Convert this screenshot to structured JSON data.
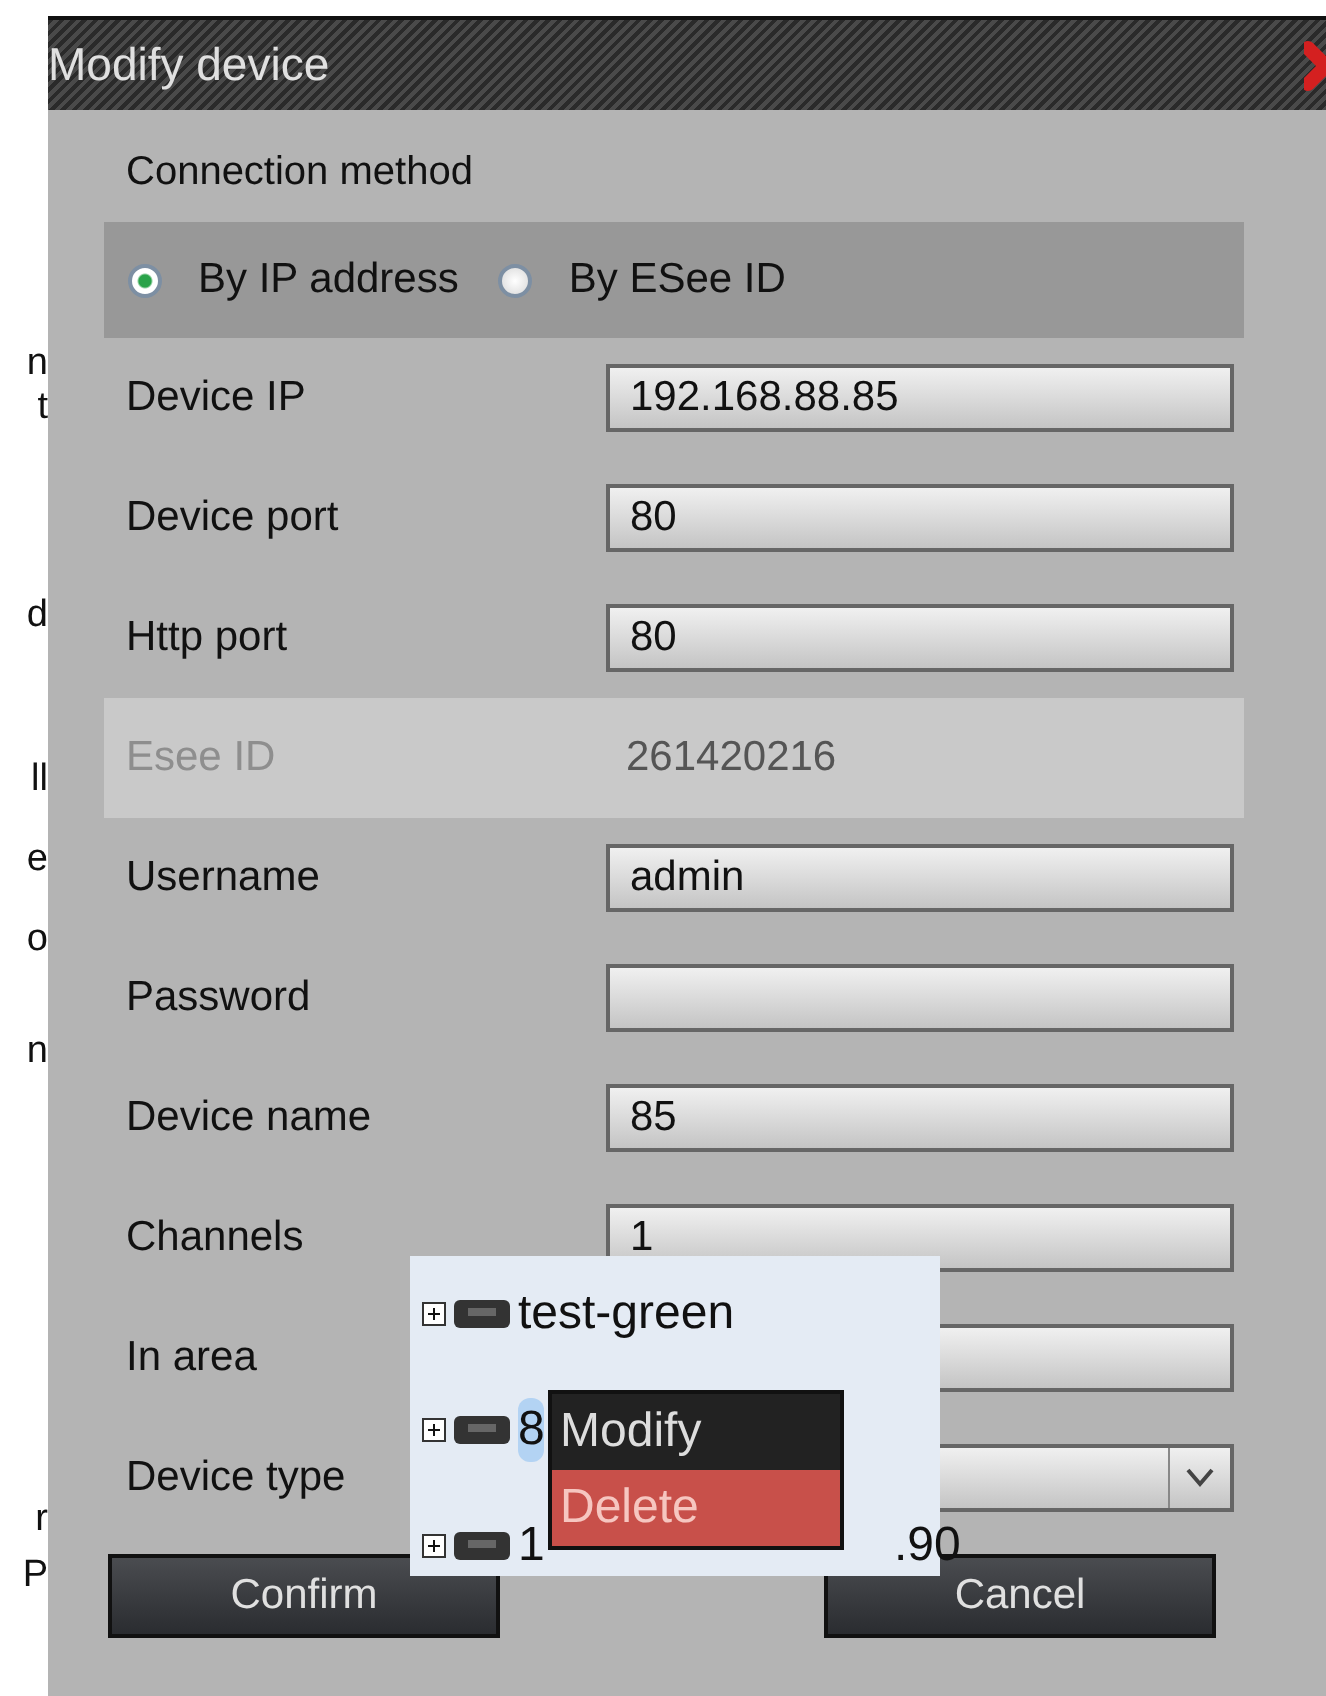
{
  "background_fragments": [
    "n",
    "t",
    "d",
    "ll",
    "e",
    "o",
    "n",
    "r",
    "P"
  ],
  "dialog": {
    "title": "Modify device",
    "connection": {
      "label": "Connection method",
      "options": [
        {
          "label": "By IP address",
          "selected": true
        },
        {
          "label": "By ESee ID",
          "selected": false
        }
      ]
    },
    "fields": [
      {
        "label": "Device IP",
        "value": "192.168.88.85",
        "kind": "input",
        "disabled": false
      },
      {
        "label": "Device port",
        "value": "80",
        "kind": "input",
        "disabled": false
      },
      {
        "label": "Http port",
        "value": "80",
        "kind": "input",
        "disabled": false
      },
      {
        "label": "Esee ID",
        "value": "261420216",
        "kind": "input",
        "disabled": true
      },
      {
        "label": "Username",
        "value": "admin",
        "kind": "input",
        "disabled": false
      },
      {
        "label": "Password",
        "kind": "input",
        "disabled": false
      },
      {
        "label": "Device name",
        "value": "85",
        "kind": "input",
        "disabled": false
      },
      {
        "label": "Channels",
        "value": "1",
        "kind": "input",
        "disabled": false
      },
      {
        "label": "In area",
        "kind": "input",
        "disabled": false
      },
      {
        "label": "Device type",
        "kind": "select",
        "disabled": false
      }
    ],
    "buttons": [
      "Confirm",
      "Cancel"
    ]
  },
  "tree_popup": {
    "items": [
      {
        "label": "test-green",
        "selected": false
      },
      {
        "label": "8",
        "selected": true
      },
      {
        "label": "1",
        "tail": ".90",
        "selected": false
      }
    ]
  },
  "context_menu": {
    "items": [
      {
        "label": "Modify",
        "selected": false
      },
      {
        "label": "Delete",
        "selected": true
      }
    ]
  }
}
